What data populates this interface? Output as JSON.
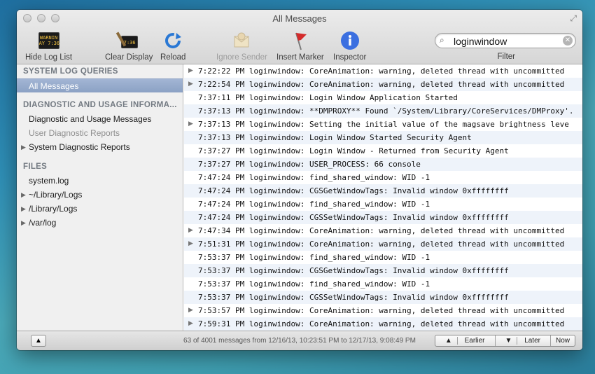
{
  "window": {
    "title": "All Messages"
  },
  "toolbar": {
    "hide_log_list": "Hide Log List",
    "clear_display": "Clear Display",
    "reload": "Reload",
    "ignore_sender": "Ignore Sender",
    "insert_marker": "Insert Marker",
    "inspector": "Inspector",
    "filter_label": "Filter",
    "console_icon_text": "WARNIN\nAY 7:36",
    "clear_icon_text": "7:36"
  },
  "search": {
    "value": "loginwindow",
    "placeholder": ""
  },
  "sidebar": {
    "sections": [
      {
        "title": "SYSTEM LOG QUERIES",
        "items": [
          {
            "label": "All Messages",
            "selected": true
          }
        ]
      },
      {
        "title": "DIAGNOSTIC AND USAGE INFORMA...",
        "items": [
          {
            "label": "Diagnostic and Usage Messages"
          },
          {
            "label": "User Diagnostic Reports",
            "dim": true
          },
          {
            "label": "System Diagnostic Reports",
            "expandable": true
          }
        ]
      },
      {
        "title": "FILES",
        "items": [
          {
            "label": "system.log"
          },
          {
            "label": "~/Library/Logs",
            "expandable": true
          },
          {
            "label": "/Library/Logs",
            "expandable": true
          },
          {
            "label": "/var/log",
            "expandable": true
          }
        ]
      }
    ]
  },
  "log": [
    {
      "time": "7:22:22 PM",
      "sender": "loginwindow",
      "msg": "CoreAnimation: warning, deleted thread with uncommitted",
      "expandable": true
    },
    {
      "time": "7:22:54 PM",
      "sender": "loginwindow",
      "msg": "CoreAnimation: warning, deleted thread with uncommitted",
      "expandable": true
    },
    {
      "time": "7:37:11 PM",
      "sender": "loginwindow",
      "msg": "Login Window Application Started"
    },
    {
      "time": "7:37:13 PM",
      "sender": "loginwindow",
      "msg": "**DMPROXY** Found `/System/Library/CoreServices/DMProxy'."
    },
    {
      "time": "7:37:13 PM",
      "sender": "loginwindow",
      "msg": "Setting the initial value of the magsave brightness leve",
      "expandable": true
    },
    {
      "time": "7:37:13 PM",
      "sender": "loginwindow",
      "msg": "Login Window Started Security Agent"
    },
    {
      "time": "7:37:27 PM",
      "sender": "loginwindow",
      "msg": "Login Window - Returned from Security Agent"
    },
    {
      "time": "7:37:27 PM",
      "sender": "loginwindow",
      "msg": "USER_PROCESS: 66 console"
    },
    {
      "time": "7:47:24 PM",
      "sender": "loginwindow",
      "msg": "find_shared_window: WID -1"
    },
    {
      "time": "7:47:24 PM",
      "sender": "loginwindow",
      "msg": "CGSGetWindowTags: Invalid window 0xffffffff"
    },
    {
      "time": "7:47:24 PM",
      "sender": "loginwindow",
      "msg": "find_shared_window: WID -1"
    },
    {
      "time": "7:47:24 PM",
      "sender": "loginwindow",
      "msg": "CGSSetWindowTags: Invalid window 0xffffffff"
    },
    {
      "time": "7:47:34 PM",
      "sender": "loginwindow",
      "msg": "CoreAnimation: warning, deleted thread with uncommitted",
      "expandable": true
    },
    {
      "time": "7:51:31 PM",
      "sender": "loginwindow",
      "msg": "CoreAnimation: warning, deleted thread with uncommitted",
      "expandable": true
    },
    {
      "time": "7:53:37 PM",
      "sender": "loginwindow",
      "msg": "find_shared_window: WID -1"
    },
    {
      "time": "7:53:37 PM",
      "sender": "loginwindow",
      "msg": "CGSGetWindowTags: Invalid window 0xffffffff"
    },
    {
      "time": "7:53:37 PM",
      "sender": "loginwindow",
      "msg": "find_shared_window: WID -1"
    },
    {
      "time": "7:53:37 PM",
      "sender": "loginwindow",
      "msg": "CGSSetWindowTags: Invalid window 0xffffffff"
    },
    {
      "time": "7:53:57 PM",
      "sender": "loginwindow",
      "msg": "CoreAnimation: warning, deleted thread with uncommitted",
      "expandable": true
    },
    {
      "time": "7:59:31 PM",
      "sender": "loginwindow",
      "msg": "CoreAnimation: warning, deleted thread with uncommitted",
      "expandable": true
    }
  ],
  "status": "63 of 4001 messages from 12/16/13, 10:23:51 PM to 12/17/13, 9:08:49 PM",
  "nav": {
    "earlier": "Earlier",
    "later": "Later",
    "now": "Now"
  },
  "icons": {
    "disclosure": "▶",
    "search": "⌕",
    "clear": "✕",
    "fullscreen": "⤢",
    "sidebar_toggle": "▲",
    "nav_earlier": "▲",
    "nav_later": "▼"
  }
}
